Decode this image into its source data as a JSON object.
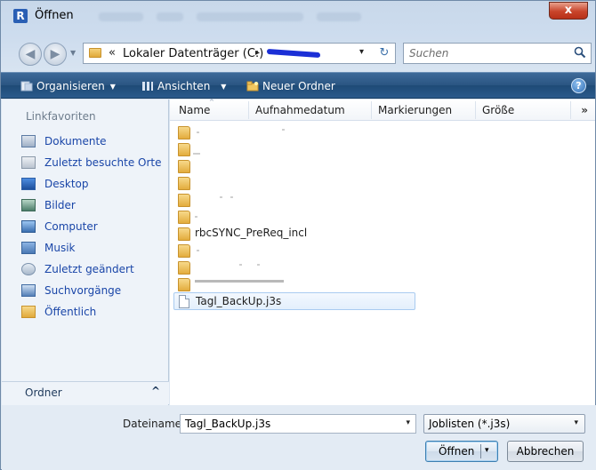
{
  "window": {
    "title": "Öffnen",
    "app_icon_letter": "R",
    "close_glyph": "x"
  },
  "address": {
    "chevron": "«",
    "path_text": "Lokaler Datenträger (C:)",
    "arrow": "▸",
    "dropdown": "▾",
    "refresh_glyph": "↻"
  },
  "search": {
    "placeholder": "Suchen"
  },
  "toolbar": {
    "organize": "Organisieren",
    "views": "Ansichten",
    "new_folder": "Neuer Ordner",
    "help": "?"
  },
  "navpane": {
    "heading": "Linkfavoriten",
    "items": [
      {
        "label": "Dokumente",
        "icon": "documents-icon",
        "color": "#5b7aa3"
      },
      {
        "label": "Zuletzt besuchte Orte",
        "icon": "recent-places-icon",
        "color": "#8a98a8"
      },
      {
        "label": "Desktop",
        "icon": "desktop-icon",
        "color": "#2d5fa7"
      },
      {
        "label": "Bilder",
        "icon": "pictures-icon",
        "color": "#4c7d6a"
      },
      {
        "label": "Computer",
        "icon": "computer-icon",
        "color": "#3b6fb0"
      },
      {
        "label": "Musik",
        "icon": "music-icon",
        "color": "#4a79b4"
      },
      {
        "label": "Zuletzt geändert",
        "icon": "recently-changed-icon",
        "color": "#7d93ad"
      },
      {
        "label": "Suchvorgänge",
        "icon": "searches-icon",
        "color": "#5480b8"
      },
      {
        "label": "Öffentlich",
        "icon": "public-folder-icon",
        "color": "#e0a93a"
      }
    ],
    "footer_label": "Ordner",
    "footer_chevron": "^"
  },
  "filelist": {
    "columns": [
      "Name",
      "Aufnahmedatum",
      "Markierungen",
      "Größe"
    ],
    "more": "»",
    "sort_indicator": "^",
    "rows": [
      {
        "type": "folder",
        "name": ""
      },
      {
        "type": "folder",
        "name": ""
      },
      {
        "type": "folder",
        "name": ""
      },
      {
        "type": "folder",
        "name": ""
      },
      {
        "type": "folder",
        "name": ""
      },
      {
        "type": "folder",
        "name": ""
      },
      {
        "type": "folder",
        "name": "rbcSYNC_PreReq_incl"
      },
      {
        "type": "folder",
        "name": ""
      },
      {
        "type": "folder",
        "name": ""
      },
      {
        "type": "folder",
        "name": ""
      },
      {
        "type": "file",
        "name": "Tagl_BackUp.j3s",
        "selected": true
      }
    ]
  },
  "bottom": {
    "filename_label": "Dateiname:",
    "filename_value": "Tagl_BackUp.j3s",
    "filetype_value": "Joblisten (*.j3s)",
    "dropdown": "▾",
    "open_label": "Öffnen",
    "cancel_label": "Abbrechen"
  },
  "colors": {
    "accent_blue": "#1a46a8",
    "toolbar": "#2a5582",
    "close": "#c8442a"
  }
}
